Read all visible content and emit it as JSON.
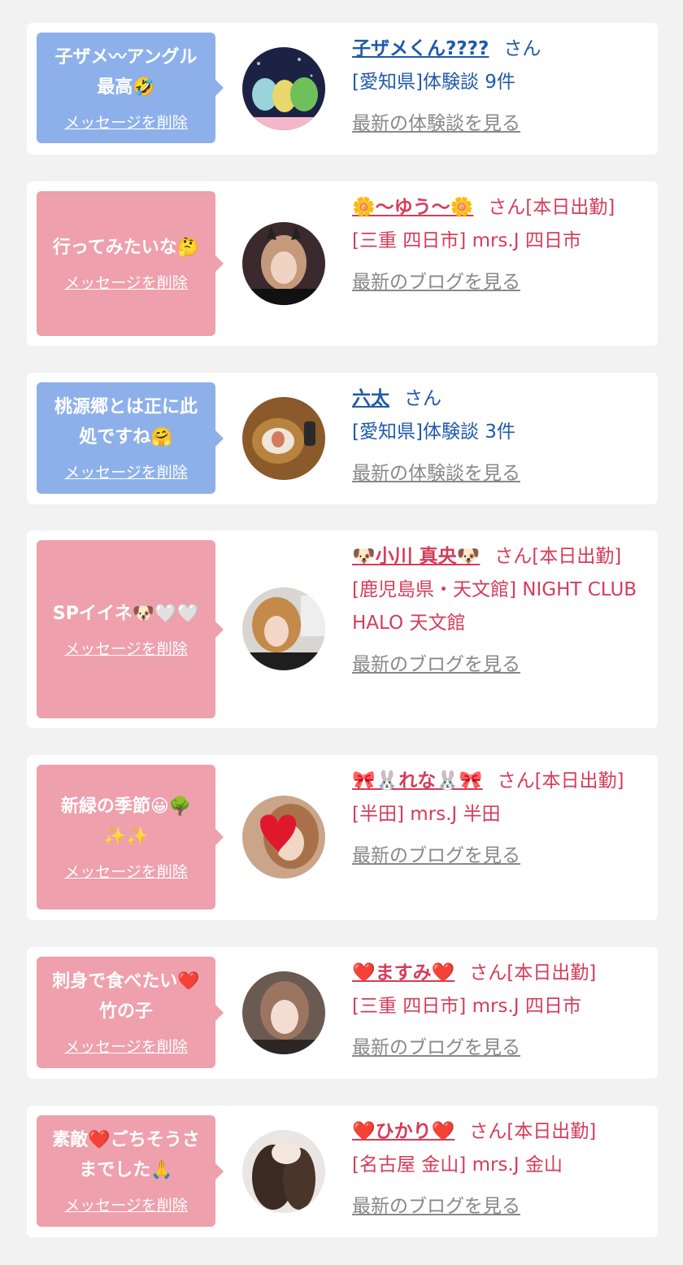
{
  "delete_label": "メッセージを削除",
  "suffix_san": "さん",
  "colors": {
    "bubble_blue": "#8eb0ea",
    "bubble_pink": "#eea0ac",
    "link_blue": "#1f5aa8",
    "link_pink": "#d63c5a",
    "muted": "#888888"
  },
  "items": [
    {
      "message": "子ザメ〰アングル\n最高🤣",
      "name": "子ザメくん????",
      "suffix": "さん",
      "meta": "[愛知県]体験談 9件",
      "link": "最新の体験談を見る",
      "theme": "blue"
    },
    {
      "message": "行ってみたいな🤔",
      "name": "🌼〜ゆう〜🌼",
      "suffix": "さん[本日出勤]",
      "meta": "[三重 四日市] mrs.J 四日市",
      "link": "最新のブログを見る",
      "theme": "pink"
    },
    {
      "message": "桃源郷とは正に此\n処ですね🤗",
      "name": "六太",
      "suffix": "さん",
      "meta": "[愛知県]体験談 3件",
      "link": "最新の体験談を見る",
      "theme": "blue"
    },
    {
      "message": "SPイイネ🐶🤍🤍",
      "name": "🐶小川 真央🐶",
      "suffix": "さん[本日出勤]",
      "meta": "[鹿児島県・天文館] NIGHT CLUB HALO 天文館",
      "link": "最新のブログを見る",
      "theme": "pink"
    },
    {
      "message": "新緑の季節😀🌳\n✨✨",
      "name": "🎀🐰れな🐰🎀",
      "suffix": "さん[本日出勤]",
      "meta": "[半田] mrs.J 半田",
      "link": "最新のブログを見る",
      "theme": "pink"
    },
    {
      "message": "刺身で食べたい❤️\n竹の子",
      "name": "❤️ますみ❤️",
      "suffix": "さん[本日出勤]",
      "meta": "[三重 四日市] mrs.J 四日市",
      "link": "最新のブログを見る",
      "theme": "pink"
    },
    {
      "message": "素敵❤️ごちそうさ\nまでした🙏",
      "name": "❤️ひかり❤️",
      "suffix": "さん[本日出勤]",
      "meta": "[名古屋 金山] mrs.J 金山",
      "link": "最新のブログを見る",
      "theme": "pink"
    }
  ]
}
